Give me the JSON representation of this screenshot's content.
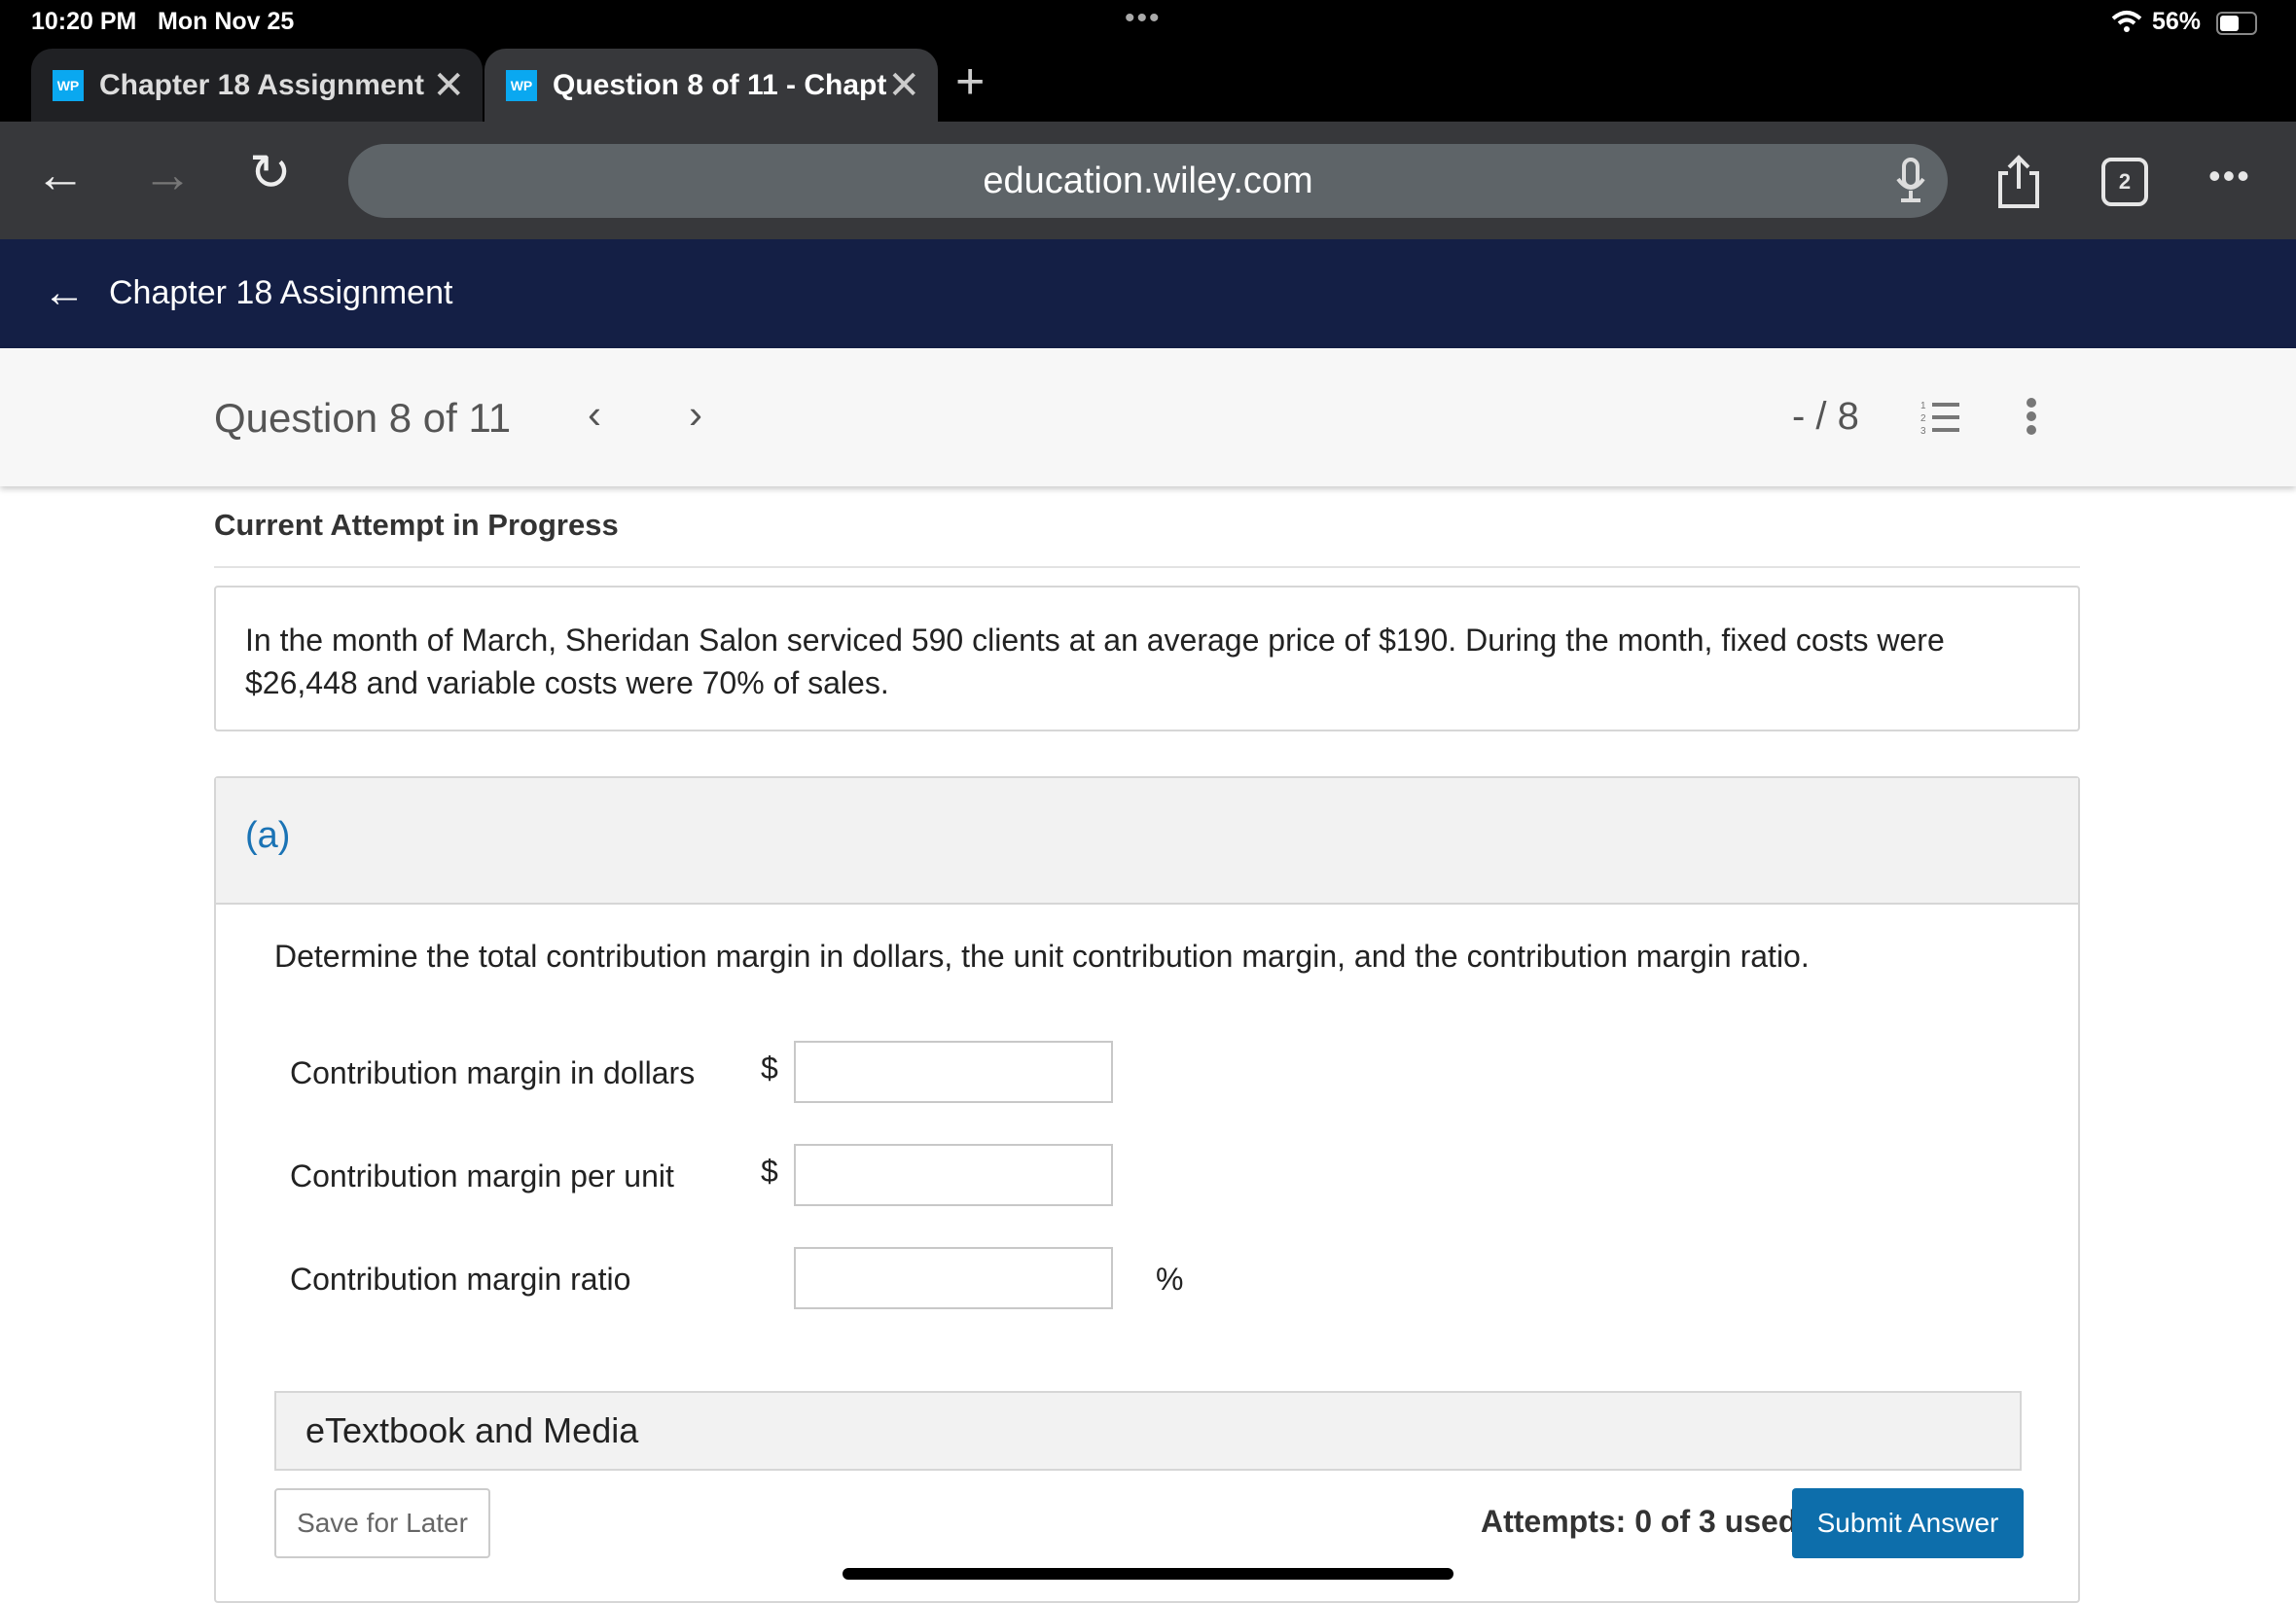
{
  "status_bar": {
    "time": "10:20 PM",
    "date": "Mon Nov 25",
    "battery": "56%",
    "battery_level": 0.56
  },
  "browser": {
    "tabs": [
      {
        "favicon": "WP",
        "title": "Chapter 18 Assignment",
        "active": false
      },
      {
        "favicon": "WP",
        "title": "Question 8 of 11 - Chapt",
        "active": true
      }
    ],
    "url": "education.wiley.com",
    "tab_count": "2"
  },
  "header": {
    "back_title": "Chapter 18 Assignment"
  },
  "question_bar": {
    "title": "Question 8 of 11",
    "score": "- / 8"
  },
  "main": {
    "attempt_heading": "Current Attempt in Progress",
    "problem_text": "In the month of March, Sheridan Salon serviced 590 clients at an average price of $190. During the month, fixed costs were $26,448 and variable costs were 70% of sales.",
    "part": {
      "label": "(a)",
      "instruction": "Determine the total contribution margin in dollars, the unit contribution margin, and the contribution margin ratio.",
      "rows": [
        {
          "label": "Contribution margin in dollars",
          "prefix": "$",
          "value": "",
          "suffix": ""
        },
        {
          "label": "Contribution margin per unit",
          "prefix": "$",
          "value": "",
          "suffix": ""
        },
        {
          "label": "Contribution margin ratio",
          "prefix": "",
          "value": "",
          "suffix": "%"
        }
      ],
      "etextbook": "eTextbook and Media",
      "save_label": "Save for Later",
      "attempts": "Attempts: 0 of 3 used",
      "submit_label": "Submit Answer"
    }
  },
  "colors": {
    "navy": "#141f45",
    "accent": "#0d6eab",
    "part_label": "#1a73b5"
  }
}
